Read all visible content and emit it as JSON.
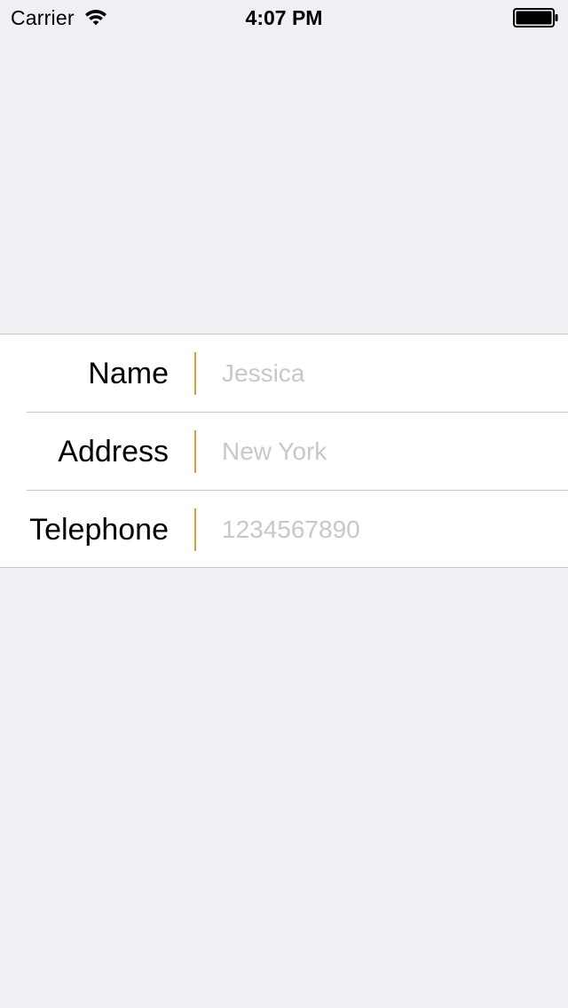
{
  "status_bar": {
    "carrier": "Carrier",
    "time": "4:07 PM",
    "wifi_icon": "wifi-icon",
    "battery_icon": "battery-icon",
    "battery_level": 1.0
  },
  "form": {
    "fields": [
      {
        "label": "Name",
        "value": "",
        "placeholder": "Jessica"
      },
      {
        "label": "Address",
        "value": "",
        "placeholder": "New York"
      },
      {
        "label": "Telephone",
        "value": "",
        "placeholder": "1234567890"
      }
    ]
  },
  "colors": {
    "background": "#efeff4",
    "cell_background": "#ffffff",
    "separator": "#c8c7cc",
    "accent_divider": "#e59a3a",
    "placeholder": "#c7c7cd"
  }
}
